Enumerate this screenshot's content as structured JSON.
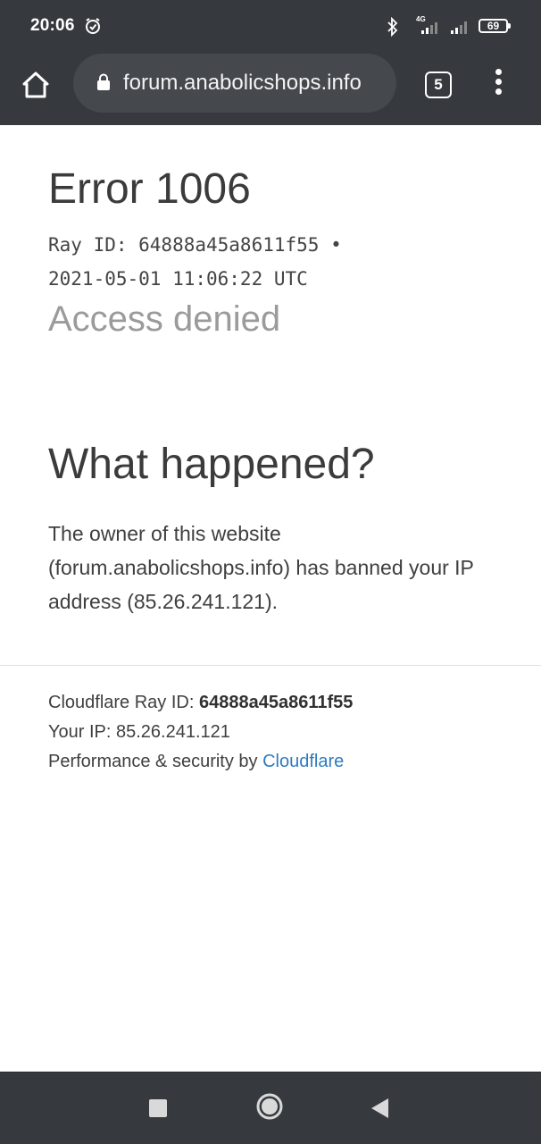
{
  "status_bar": {
    "time": "20:06",
    "network_label": "4G",
    "battery": "69"
  },
  "toolbar": {
    "url": "forum.anabolicshops.info",
    "tab_count": "5"
  },
  "page": {
    "error_title": "Error 1006",
    "ray_line": "Ray ID: 64888a45a8611f55 •",
    "date_line": "2021-05-01 11:06:22 UTC",
    "access_denied": "Access denied",
    "what_happened_heading": "What happened?",
    "explanation": "The owner of this website (forum.anabolicshops.info) has banned your IP address (85.26.241.121)."
  },
  "footer": {
    "ray_label": "Cloudflare Ray ID: ",
    "ray_value": "64888a45a8611f55",
    "ip_label": "Your IP: 85.26.241.121",
    "perf_label": "Performance & security by ",
    "cloudflare_link": "Cloudflare"
  },
  "colors": {
    "chrome_bar": "#36393d",
    "omnibox": "#45484d",
    "link": "#2f7bbf"
  }
}
